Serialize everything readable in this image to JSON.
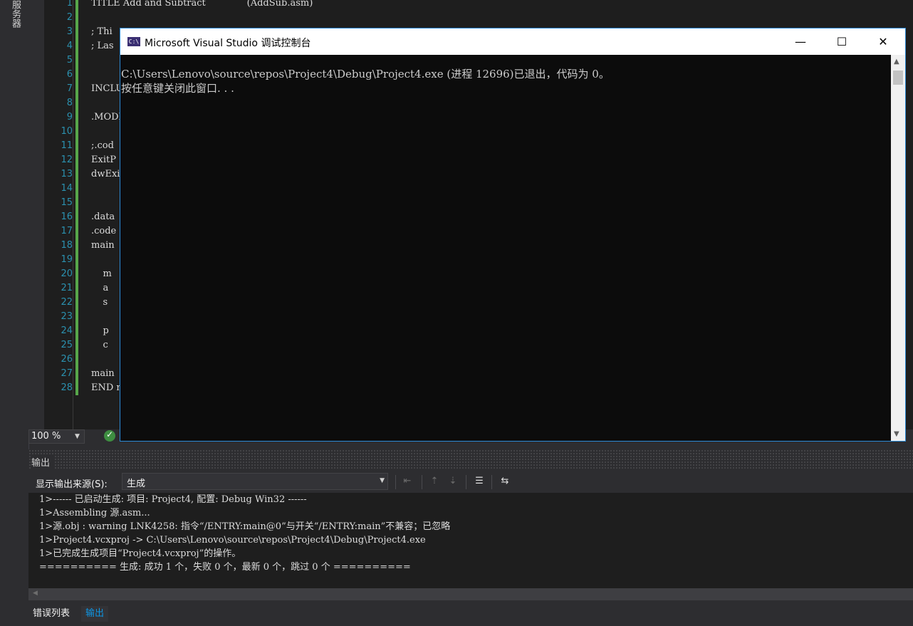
{
  "left_strip": {
    "tab_label": "服务器"
  },
  "editor": {
    "lines": [
      {
        "num": "1",
        "text": "TITLE Add and Subtract              (AddSub.asm)"
      },
      {
        "num": "2",
        "text": ""
      },
      {
        "num": "3",
        "text": "; Thi"
      },
      {
        "num": "4",
        "text": "; Las"
      },
      {
        "num": "5",
        "text": ""
      },
      {
        "num": "6",
        "text": ""
      },
      {
        "num": "7",
        "text": "INCLU"
      },
      {
        "num": "8",
        "text": ""
      },
      {
        "num": "9",
        "text": ".MODE"
      },
      {
        "num": "10",
        "text": ""
      },
      {
        "num": "11",
        "text": ";.cod"
      },
      {
        "num": "12",
        "text": "ExitP"
      },
      {
        "num": "13",
        "text": "dwExi"
      },
      {
        "num": "14",
        "text": ""
      },
      {
        "num": "15",
        "text": ""
      },
      {
        "num": "16",
        "text": ".data"
      },
      {
        "num": "17",
        "text": ".code"
      },
      {
        "num": "18",
        "text": "main "
      },
      {
        "num": "19",
        "text": ""
      },
      {
        "num": "20",
        "text": "    m"
      },
      {
        "num": "21",
        "text": "    a"
      },
      {
        "num": "22",
        "text": "    s"
      },
      {
        "num": "23",
        "text": ""
      },
      {
        "num": "24",
        "text": "    p"
      },
      {
        "num": "25",
        "text": "    c"
      },
      {
        "num": "26",
        "text": ""
      },
      {
        "num": "27",
        "text": "main "
      },
      {
        "num": "28",
        "text": "END m"
      }
    ],
    "zoom": "100 %"
  },
  "console": {
    "title": "Microsoft Visual Studio 调试控制台",
    "icon_label": "C:\\",
    "lines": [
      "C:\\Users\\Lenovo\\source\\repos\\Project4\\Debug\\Project4.exe (进程 12696)已退出，代码为 0。",
      "按任意键关闭此窗口. . ."
    ],
    "minimize": "—",
    "maximize": "☐",
    "close": "✕"
  },
  "output": {
    "title": "输出",
    "source_label": "显示输出来源(S):",
    "source_value": "生成",
    "lines": [
      "1>------ 已启动生成: 项目: Project4, 配置: Debug Win32 ------",
      "1>Assembling 源.asm...",
      "1>源.obj : warning LNK4258: 指令“/ENTRY:main@0”与开关“/ENTRY:main”不兼容；已忽略",
      "1>Project4.vcxproj -> C:\\Users\\Lenovo\\source\\repos\\Project4\\Debug\\Project4.exe",
      "1>已完成生成项目“Project4.vcxproj”的操作。",
      "========== 生成: 成功 1 个，失败 0 个，最新 0 个，跳过 0 个 =========="
    ]
  },
  "bottom_tabs": [
    {
      "label": "错误列表",
      "active": false
    },
    {
      "label": "输出",
      "active": true
    }
  ],
  "colors": {
    "accent": "#0e97e6",
    "line_numbers": "#2b91af",
    "change_marker": "#57a64a",
    "console_border": "#2b8ad6"
  }
}
